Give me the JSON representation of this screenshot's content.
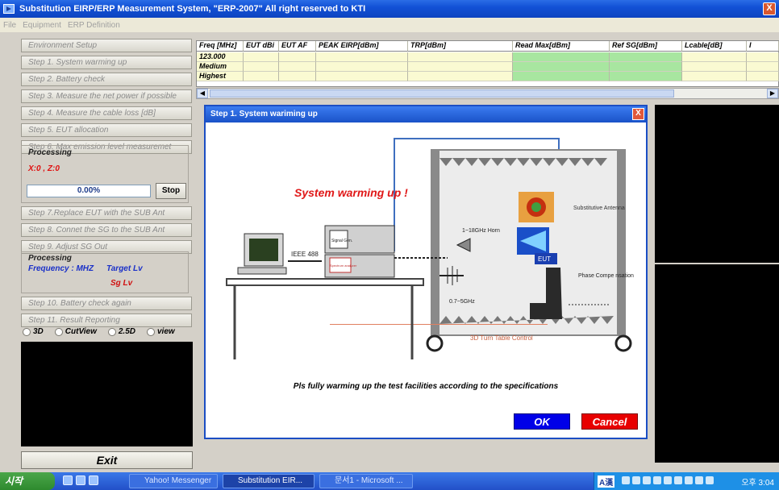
{
  "window": {
    "title": "Substitution EIRP/ERP Measurement System, \"ERP-2007\" All right reserved to KTI",
    "close_glyph": "X"
  },
  "menu": [
    "File",
    "Equipment",
    "ERP Definition"
  ],
  "steps": [
    "Environment Setup",
    "Step 1. System warming up",
    "Step 2. Battery check",
    "Step 3. Measure the net power if possible",
    "Step 4. Measure the cable loss [dB]",
    "Step 5. EUT allocation",
    "Step 6. Max emission level measuremet"
  ],
  "processing1": {
    "label": "Processing",
    "xz": "X:0 , Z:0",
    "progress": "0.00%",
    "stop": "Stop"
  },
  "steps2": [
    "Step 7.Replace EUT with the SUB Ant",
    "Step 8. Connet the SG to the SUB Ant",
    "Step 9. Adjust SG Out"
  ],
  "processing2": {
    "label": "Processing",
    "frequency": "Frequency : MHZ",
    "target": "Target Lv",
    "sglv": "Sg Lv"
  },
  "steps3": [
    "Step 10. Battery check again",
    "Step 11. Result Reporting"
  ],
  "views": [
    "3D",
    "CutView",
    "2.5D",
    "view"
  ],
  "exit": "Exit",
  "table": {
    "headers": [
      "Freq [MHz]",
      "EUT dBi",
      "EUT AF",
      "PEAK EIRP[dBm]",
      "TRP[dBm]",
      "Read Max[dBm]",
      "Ref SG[dBm]",
      "Lcable[dB]",
      "I"
    ],
    "rows": [
      "123.000",
      "Medium",
      "Highest"
    ]
  },
  "dialog": {
    "title": "Step 1. System wariming up",
    "close_glyph": "X",
    "headline": "System warming up !",
    "labels": {
      "signal_gen": "Signal Gen.",
      "spectrum": "Spectrum analyzer",
      "ieee": "IEEE 488",
      "horn": "1~18GHz Horn",
      "band": "0.7~5GHz",
      "sub_ant": "Substitutive Antenna",
      "eut": "EUT",
      "phase": "Phase Compe nsation",
      "turntable": "3D Turn Table Control"
    },
    "message": "Pls fully warming up the test facilities according to the specifications",
    "ok": "OK",
    "cancel": "Cancel"
  },
  "taskbar": {
    "start": "시작",
    "tasks": [
      "Yahoo! Messenger",
      "Substitution EIR...",
      "문서1 - Microsoft ..."
    ],
    "ime": "A漢",
    "clock": "오후 3:04"
  }
}
